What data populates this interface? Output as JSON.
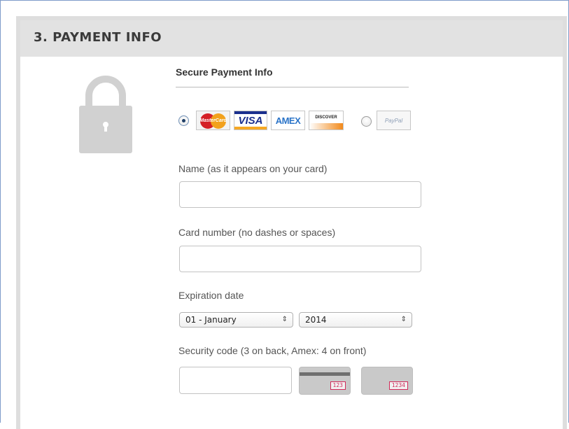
{
  "panel": {
    "title": "3. PAYMENT INFO"
  },
  "icons": {
    "lock": "lock-icon"
  },
  "secure": {
    "title": "Secure Payment Info"
  },
  "payment_methods": {
    "card_selected": true,
    "paypal_selected": false,
    "logos": {
      "mastercard": "MasterCard",
      "visa": "VISA",
      "amex": "AMEX",
      "discover": "DISCOVER",
      "paypal": "PayPal"
    }
  },
  "form": {
    "name_label": "Name (as it appears on your card)",
    "name_value": "",
    "card_label": "Card number (no dashes or spaces)",
    "card_value": "",
    "expiration_label": "Expiration date",
    "month_selected": "01 - January",
    "year_selected": "2014",
    "security_label": "Security code (3 on back, Amex: 4 on front)",
    "security_value": "",
    "cvv_back_example": "123",
    "cvv_front_example": "1234"
  },
  "colors": {
    "header_bg": "#e2e2e2",
    "radio_selected": "#1e3e66",
    "cvv_highlight": "#d22b5a"
  }
}
